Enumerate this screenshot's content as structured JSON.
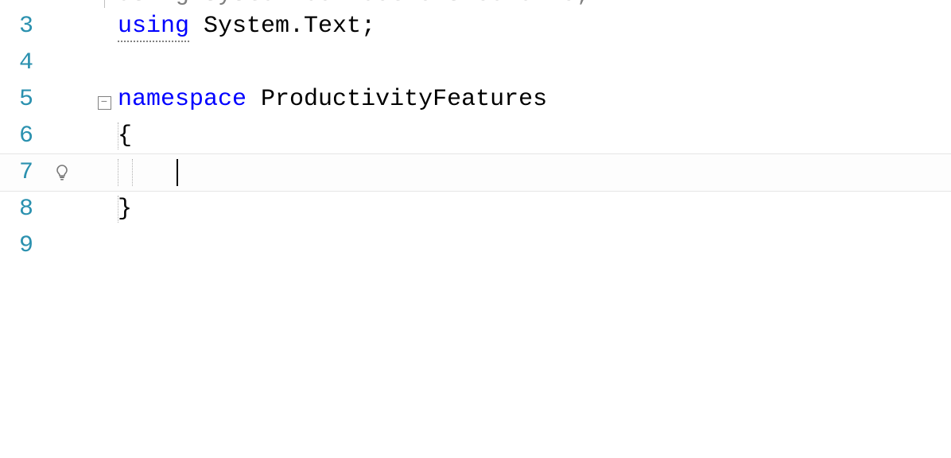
{
  "partial_line": {
    "text": "using System.Collections.Generic;"
  },
  "lines": [
    {
      "num": "3",
      "tokens": [
        {
          "text": "using",
          "cls": "tok-keyword",
          "underline": true
        },
        {
          "text": " ",
          "cls": "tok-plain"
        },
        {
          "text": "System.Text;",
          "cls": "tok-plain"
        }
      ],
      "fold_vert": true,
      "fold_vert_bottom_only": true
    },
    {
      "num": "4",
      "tokens": [],
      "fold_vert": false
    },
    {
      "num": "5",
      "fold_box": "−",
      "tokens": [
        {
          "text": "namespace",
          "cls": "tok-keyword"
        },
        {
          "text": " ",
          "cls": "tok-plain"
        },
        {
          "text": "ProductivityFeatures",
          "cls": "tok-plain"
        }
      ]
    },
    {
      "num": "6",
      "fold_vert": true,
      "guide1": true,
      "tokens": [
        {
          "text": "{",
          "cls": "tok-plain"
        }
      ]
    },
    {
      "num": "7",
      "lightbulb": true,
      "modified": true,
      "fold_vert": true,
      "guide1": true,
      "guide2": true,
      "current": true,
      "caret": true,
      "tokens": [
        {
          "text": "    ",
          "cls": "tok-plain"
        }
      ]
    },
    {
      "num": "8",
      "fold_vert": true,
      "guide1": true,
      "tokens": [
        {
          "text": "}",
          "cls": "tok-plain"
        }
      ]
    },
    {
      "num": "9",
      "tokens": []
    }
  ],
  "icons": {
    "lightbulb": "lightbulb-icon",
    "fold_minus": "fold-minus-icon"
  }
}
